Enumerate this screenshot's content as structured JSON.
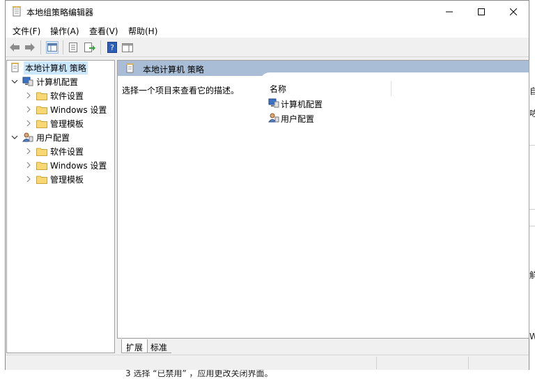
{
  "window": {
    "title": "本地组策略编辑器"
  },
  "menu": [
    "文件(F)",
    "操作(A)",
    "查看(V)",
    "帮助(H)"
  ],
  "tree": {
    "root": "本地计算机 策略",
    "computer": "计算机配置",
    "computer_children": [
      "软件设置",
      "Windows 设置",
      "管理模板"
    ],
    "user": "用户配置",
    "user_children": [
      "软件设置",
      "Windows 设置",
      "管理模板"
    ]
  },
  "content": {
    "header": "本地计算机 策略",
    "description": "选择一个项目来查看它的描述。",
    "column_name": "名称",
    "items": [
      "计算机配置",
      "用户配置"
    ]
  },
  "tabs": [
    "扩展",
    "标准"
  ],
  "background_doc": {
    "right_fragments": [
      "自",
      "咗",
      "W",
      "觧"
    ],
    "bottom_text": "3   选择 “已禁用” ，应用更改关闭界面。"
  },
  "colors": {
    "header_bg": "#a9bed6",
    "selection_bg": "#cce8ff",
    "window_bg": "#f0f0f0"
  }
}
